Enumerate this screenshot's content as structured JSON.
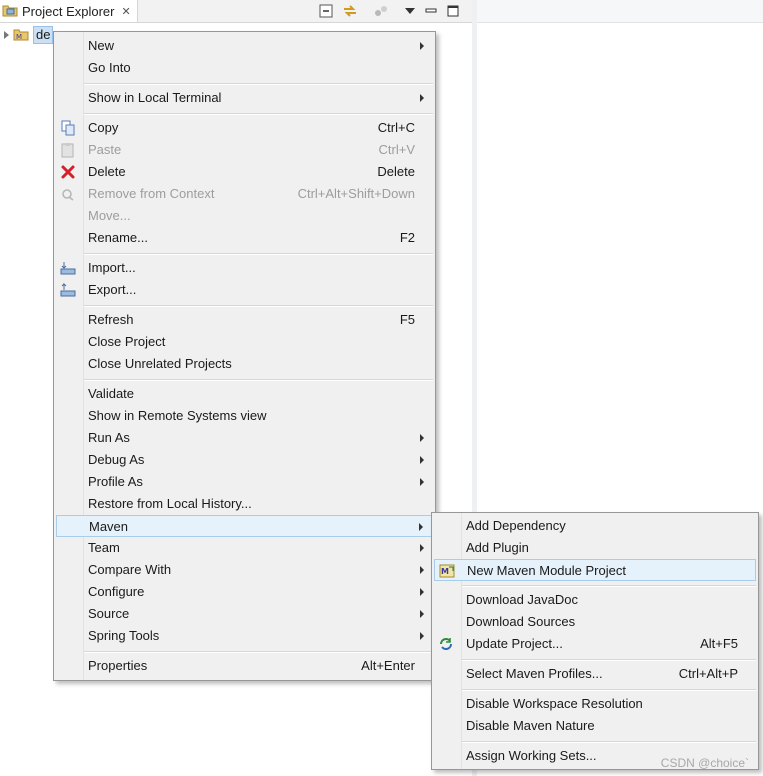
{
  "explorer": {
    "tab_title": "Project Explorer",
    "close_glyph": "✕",
    "project_name": "de"
  },
  "context_menu": {
    "items": [
      {
        "label": "New",
        "accel": "",
        "submenu": true
      },
      {
        "label": "Go Into",
        "accel": ""
      },
      {
        "label": "Show in Local Terminal",
        "accel": "",
        "submenu": true
      },
      {
        "label": "Copy",
        "accel": "Ctrl+C",
        "icon": "copy-icon"
      },
      {
        "label": "Paste",
        "accel": "Ctrl+V",
        "icon": "paste-icon",
        "disabled": true
      },
      {
        "label": "Delete",
        "accel": "Delete",
        "icon": "delete-icon"
      },
      {
        "label": "Remove from Context",
        "accel": "Ctrl+Alt+Shift+Down",
        "icon": "remove-context-icon",
        "disabled": true
      },
      {
        "label": "Move...",
        "accel": "",
        "disabled": true
      },
      {
        "label": "Rename...",
        "accel": "F2"
      },
      {
        "label": "Import...",
        "accel": "",
        "icon": "import-icon"
      },
      {
        "label": "Export...",
        "accel": "",
        "icon": "export-icon"
      },
      {
        "label": "Refresh",
        "accel": "F5"
      },
      {
        "label": "Close Project",
        "accel": ""
      },
      {
        "label": "Close Unrelated Projects",
        "accel": ""
      },
      {
        "label": "Validate",
        "accel": ""
      },
      {
        "label": "Show in Remote Systems view",
        "accel": ""
      },
      {
        "label": "Run As",
        "accel": "",
        "submenu": true
      },
      {
        "label": "Debug As",
        "accel": "",
        "submenu": true
      },
      {
        "label": "Profile As",
        "accel": "",
        "submenu": true
      },
      {
        "label": "Restore from Local History...",
        "accel": ""
      },
      {
        "label": "Maven",
        "accel": "",
        "submenu": true,
        "active": true
      },
      {
        "label": "Team",
        "accel": "",
        "submenu": true
      },
      {
        "label": "Compare With",
        "accel": "",
        "submenu": true
      },
      {
        "label": "Configure",
        "accel": "",
        "submenu": true
      },
      {
        "label": "Source",
        "accel": "",
        "submenu": true
      },
      {
        "label": "Spring Tools",
        "accel": "",
        "submenu": true
      },
      {
        "label": "Properties",
        "accel": "Alt+Enter"
      }
    ]
  },
  "maven_submenu": {
    "items": [
      {
        "label": "Add Dependency",
        "accel": ""
      },
      {
        "label": "Add Plugin",
        "accel": ""
      },
      {
        "label": "New Maven Module Project",
        "accel": "",
        "icon": "maven-module-icon",
        "hover": true
      },
      {
        "label": "Download JavaDoc",
        "accel": ""
      },
      {
        "label": "Download Sources",
        "accel": ""
      },
      {
        "label": "Update Project...",
        "accel": "Alt+F5",
        "icon": "update-project-icon"
      },
      {
        "label": "Select Maven Profiles...",
        "accel": "Ctrl+Alt+P"
      },
      {
        "label": "Disable Workspace Resolution",
        "accel": ""
      },
      {
        "label": "Disable Maven Nature",
        "accel": ""
      },
      {
        "label": "Assign Working Sets...",
        "accel": ""
      }
    ]
  },
  "watermark": "CSDN @choice`"
}
